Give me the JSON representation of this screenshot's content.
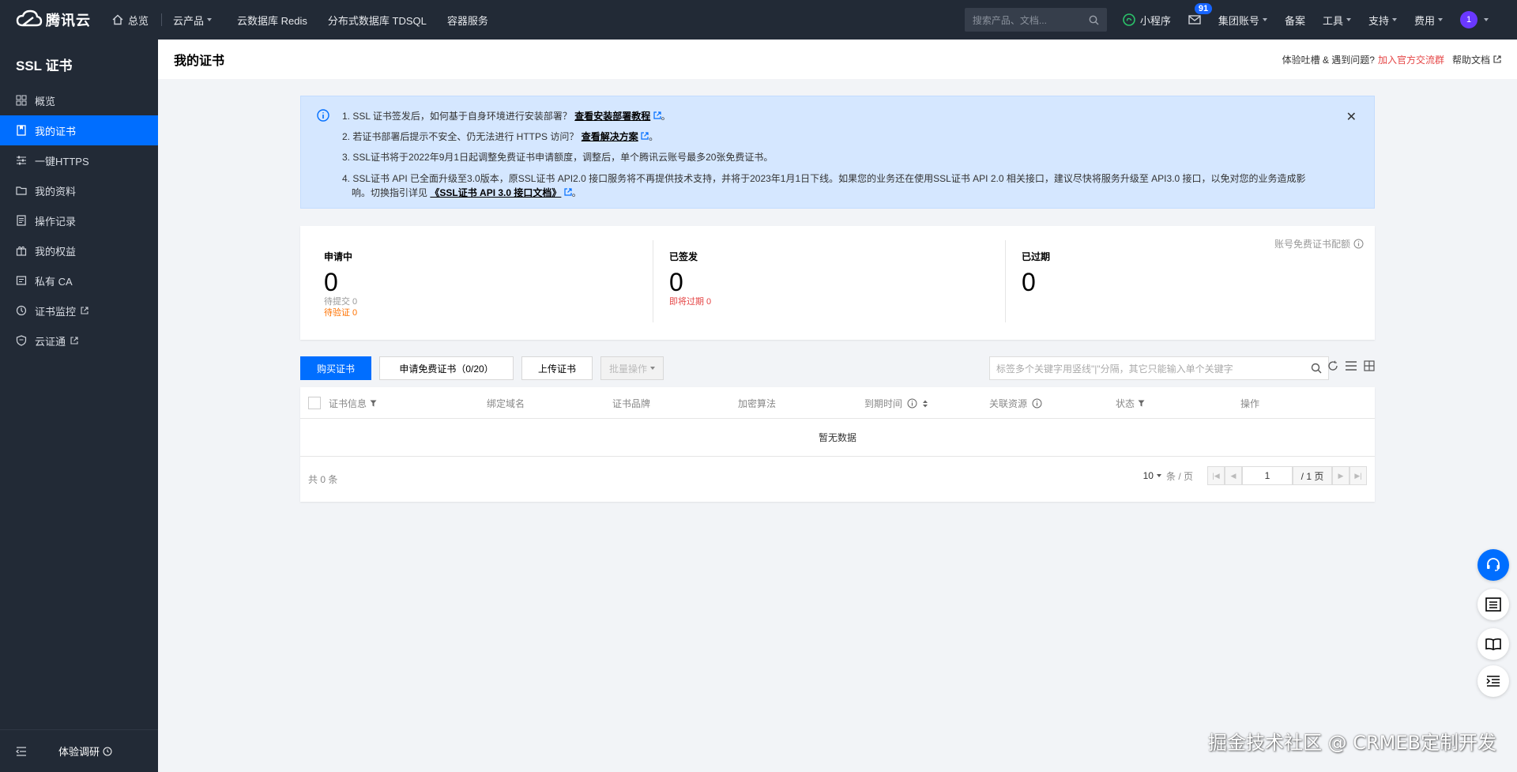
{
  "topnav": {
    "brand": "腾讯云",
    "overview": "总览",
    "products": "云产品",
    "links": [
      "云数据库 Redis",
      "分布式数据库 TDSQL",
      "容器服务"
    ],
    "search_placeholder": "搜索产品、文档...",
    "miniprogram": "小程序",
    "messages_badge": "91",
    "account": "集团账号",
    "filing": "备案",
    "tools": "工具",
    "support": "支持",
    "billing": "费用",
    "avatar": "1"
  },
  "sidebar": {
    "title": "SSL 证书",
    "items": [
      {
        "label": "概览",
        "icon": "grid-icon"
      },
      {
        "label": "我的证书",
        "icon": "certificate-icon"
      },
      {
        "label": "一键HTTPS",
        "icon": "sliders-icon"
      },
      {
        "label": "我的资料",
        "icon": "folder-icon"
      },
      {
        "label": "操作记录",
        "icon": "document-icon"
      },
      {
        "label": "我的权益",
        "icon": "gift-icon"
      },
      {
        "label": "私有 CA",
        "icon": "ca-icon"
      },
      {
        "label": "证书监控",
        "icon": "monitor-icon"
      },
      {
        "label": "云证通",
        "icon": "shield-icon"
      }
    ],
    "footer_survey": "体验调研"
  },
  "page": {
    "title": "我的证书",
    "feedback": "体验吐槽 & 遇到问题?",
    "join_group": "加入官方交流群",
    "help_docs": "帮助文档"
  },
  "notice": {
    "line1_text": "1. SSL 证书签发后，如何基于自身环境进行安装部署？",
    "line1_link": "查看安装部署教程",
    "line2_text": "2. 若证书部署后提示不安全、仍无法进行 HTTPS 访问？",
    "line2_link": "查看解决方案",
    "line3_text": "3. SSL证书将于2022年9月1日起调整免费证书申请额度，调整后，单个腾讯云账号最多20张免费证书。",
    "line4_text": "4. SSL证书 API 已全面升级至3.0版本，原SSL证书 API2.0 接口服务将不再提供技术支持，并将于2023年1月1日下线。如果您的业务还在使用SSL证书 API 2.0 相关接口，建议尽快将服务升级至 API3.0 接口，以免对您的业务造成影",
    "line4_text_b": "响。切换指引详见",
    "line4_link": "《SSL证书 API 3.0 接口文档》"
  },
  "stats": {
    "applying": {
      "label": "申请中",
      "value": "0",
      "pending_submit": "待提交 0",
      "pending_verify": "待验证 0"
    },
    "issued": {
      "label": "已签发",
      "value": "0",
      "expiring": "即将过期 0"
    },
    "expired": {
      "label": "已过期",
      "value": "0"
    },
    "quota": "账号免费证书配额"
  },
  "toolbar": {
    "buy": "购买证书",
    "apply_free": "申请免费证书（0/20）",
    "upload": "上传证书",
    "batch": "批量操作",
    "search_placeholder": "标签多个关键字用竖线\"|\"分隔，其它只能输入单个关键字"
  },
  "table": {
    "columns": [
      "证书信息",
      "绑定域名",
      "证书品牌",
      "加密算法",
      "到期时间",
      "关联资源",
      "状态",
      "操作"
    ],
    "empty": "暂无数据",
    "total": "共 0 条",
    "page_size": "10",
    "per_page": "条 / 页",
    "page": "1",
    "page_total": "/ 1 页"
  },
  "watermark": "掘金技术社区 @ CRMEB定制开发"
}
